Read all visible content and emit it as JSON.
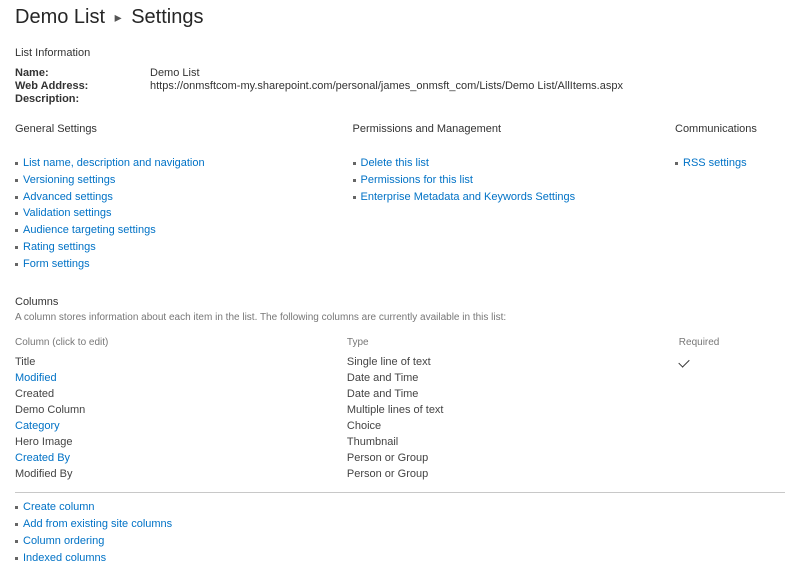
{
  "breadcrumb": {
    "list_name": "Demo List",
    "page": "Settings"
  },
  "list_info": {
    "heading": "List Information",
    "labels": {
      "name": "Name:",
      "web": "Web Address:",
      "desc": "Description:"
    },
    "name": "Demo List",
    "web_address": "https://onmsftcom-my.sharepoint.com/personal/james_onmsft_com/Lists/Demo List/AllItems.aspx",
    "description": ""
  },
  "sections": {
    "general": {
      "title": "General Settings",
      "items": [
        "List name, description and navigation",
        "Versioning settings",
        "Advanced settings",
        "Validation settings",
        "Audience targeting settings",
        "Rating settings",
        "Form settings"
      ]
    },
    "permissions": {
      "title": "Permissions and Management",
      "items": [
        "Delete this list",
        "Permissions for this list",
        "Enterprise Metadata and Keywords Settings"
      ]
    },
    "communications": {
      "title": "Communications",
      "items": [
        "RSS settings"
      ]
    }
  },
  "columns": {
    "title": "Columns",
    "description": "A column stores information about each item in the list. The following columns are currently available in this list:",
    "headers": {
      "name": "Column (click to edit)",
      "type": "Type",
      "required": "Required"
    },
    "rows": [
      {
        "name": "Title",
        "type": "Single line of text",
        "required": true,
        "link": false
      },
      {
        "name": "Modified",
        "type": "Date and Time",
        "required": false,
        "link": true
      },
      {
        "name": "Created",
        "type": "Date and Time",
        "required": false,
        "link": false
      },
      {
        "name": "Demo Column",
        "type": "Multiple lines of text",
        "required": false,
        "link": false
      },
      {
        "name": "Category",
        "type": "Choice",
        "required": false,
        "link": true
      },
      {
        "name": "Hero Image",
        "type": "Thumbnail",
        "required": false,
        "link": false
      },
      {
        "name": "Created By",
        "type": "Person or Group",
        "required": false,
        "link": true
      },
      {
        "name": "Modified By",
        "type": "Person or Group",
        "required": false,
        "link": false
      }
    ],
    "actions": [
      "Create column",
      "Add from existing site columns",
      "Column ordering",
      "Indexed columns"
    ]
  }
}
